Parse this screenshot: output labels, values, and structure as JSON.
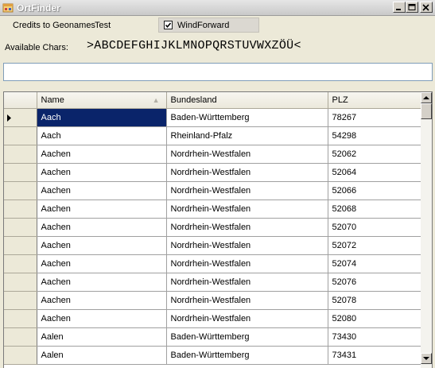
{
  "window": {
    "title": "OrtFinder",
    "min_glyph": "_",
    "max_glyph": "□",
    "close_glyph": "×"
  },
  "menu": {
    "credits": "Credits to Geonames",
    "test": "Test",
    "wind_forward": "WindForward",
    "wind_forward_checked": true
  },
  "available": {
    "label": "Available Chars:",
    "chars": ">ABCDEFGHIJKLMNOPQRSTUVWXZÖÜ<"
  },
  "search": {
    "value": "",
    "placeholder": ""
  },
  "grid": {
    "columns": [
      "Name",
      "Bundesland",
      "PLZ"
    ],
    "sorted_column": "Name",
    "selected_row": 0,
    "rows": [
      [
        "Aach",
        "Baden-Württemberg",
        "78267"
      ],
      [
        "Aach",
        "Rheinland-Pfalz",
        "54298"
      ],
      [
        "Aachen",
        "Nordrhein-Westfalen",
        "52062"
      ],
      [
        "Aachen",
        "Nordrhein-Westfalen",
        "52064"
      ],
      [
        "Aachen",
        "Nordrhein-Westfalen",
        "52066"
      ],
      [
        "Aachen",
        "Nordrhein-Westfalen",
        "52068"
      ],
      [
        "Aachen",
        "Nordrhein-Westfalen",
        "52070"
      ],
      [
        "Aachen",
        "Nordrhein-Westfalen",
        "52072"
      ],
      [
        "Aachen",
        "Nordrhein-Westfalen",
        "52074"
      ],
      [
        "Aachen",
        "Nordrhein-Westfalen",
        "52076"
      ],
      [
        "Aachen",
        "Nordrhein-Westfalen",
        "52078"
      ],
      [
        "Aachen",
        "Nordrhein-Westfalen",
        "52080"
      ],
      [
        "Aalen",
        "Baden-Württemberg",
        "73430"
      ],
      [
        "Aalen",
        "Baden-Württemberg",
        "73431"
      ]
    ]
  },
  "colors": {
    "selection": "#0a246a",
    "window_bg": "#ece9d8"
  }
}
